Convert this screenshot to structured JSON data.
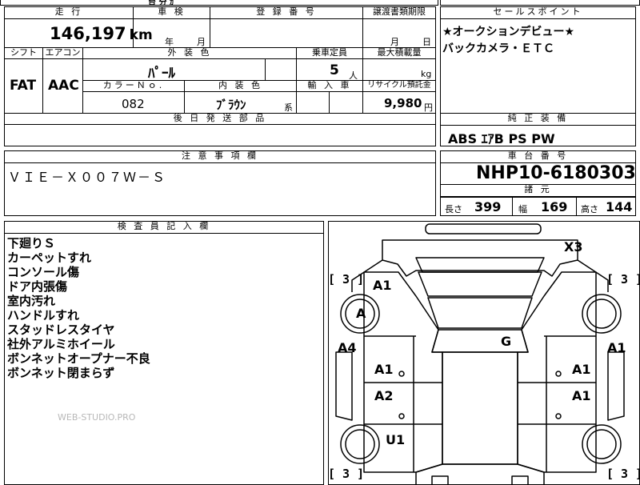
{
  "top_strip": {
    "partial_text": "台 分 ｶ"
  },
  "mileage": {
    "header": "走 行",
    "value": "146,197",
    "unit": "km"
  },
  "inspection": {
    "header": "車 検",
    "year_unit": "年",
    "month_unit": "月"
  },
  "registration": {
    "header": "登 録 番 号"
  },
  "transfer_deadline": {
    "header": "譲渡書類期限",
    "month_unit": "月",
    "day_unit": "日"
  },
  "sales_points": {
    "header": "セールスポイント",
    "lines": [
      "★オークションデビュー★",
      "バックカメラ・ＥＴＣ"
    ]
  },
  "shift": {
    "header": "シフト",
    "value": "FAT"
  },
  "aircon": {
    "header": "エアコン",
    "value": "AAC"
  },
  "exterior_color": {
    "header": "外 装 色",
    "value": "ﾊﾟｰﾙ"
  },
  "capacity": {
    "header": "乗車定員",
    "value": "5",
    "unit": "人"
  },
  "max_load": {
    "header": "最大積載量",
    "unit": "kg"
  },
  "color_no": {
    "header": "カラーＮｏ.",
    "value": "082"
  },
  "interior_color": {
    "header": "内 装 色",
    "value": "ﾌﾞﾗｳﾝ",
    "suffix": "系"
  },
  "import": {
    "header": "輸 入 車"
  },
  "recycle": {
    "header": "リサイクル預託金",
    "value": "9,980",
    "unit": "円"
  },
  "later_parts": {
    "header": "後 日 発 送 部 品"
  },
  "genuine_equipment": {
    "header": "純 正 装 備",
    "value": "ABS ｴｱB PS PW"
  },
  "caution": {
    "header": "注 意 事 項 欄",
    "value": "ＶＩＥ－Ｘ００７Ｗ－Ｓ"
  },
  "chassis": {
    "header": "車 台 番 号",
    "value": "NHP10-6180303"
  },
  "specs": {
    "header": "諸 元",
    "length_label": "長さ",
    "length": "399",
    "width_label": "幅",
    "width": "169",
    "height_label": "高さ",
    "height": "144"
  },
  "inspector_notes": {
    "header": "検 査 員 記 入 欄",
    "lines": [
      "下廻りＳ",
      "カーペットすれ",
      "コンソール傷",
      "ドア内張傷",
      "室内汚れ",
      "ハンドルすれ",
      "スタッドレスタイヤ",
      "社外アルミホイール",
      "ボンネットオープナー不良",
      "ボンネット閉まらず"
    ]
  },
  "watermark": "WEB-STUDIO.PRO",
  "diagram": {
    "tire_rating": "[ 3 ]",
    "labels": {
      "x3": "X3",
      "a1_front_left": "A1",
      "a_front_left_wheel": "A",
      "a4": "A4",
      "g": "G",
      "a1_right_fender": "A1",
      "a1_left_door": "A1",
      "a1_right_door": "A1",
      "a2": "A2",
      "a1_right_rear_door": "A1",
      "u1": "U1"
    }
  }
}
